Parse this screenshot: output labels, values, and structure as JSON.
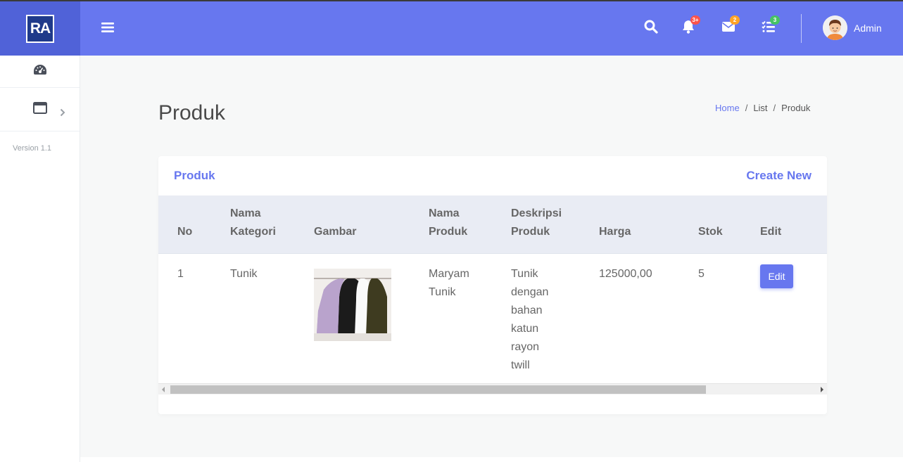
{
  "brand": {
    "logo_text": "RA"
  },
  "sidebar": {
    "version": "Version 1.1"
  },
  "header": {
    "notifications_count": "3+",
    "messages_count": "2",
    "tasks_count": "3",
    "user_name": "Admin",
    "colors": {
      "header_bg": "#6777ef",
      "brand_bg": "#5062d8",
      "badge_red": "#fc544b",
      "badge_orange": "#ffa426",
      "badge_green": "#47c363"
    }
  },
  "page": {
    "title": "Produk",
    "breadcrumb": [
      "Home",
      "List",
      "Produk"
    ]
  },
  "card": {
    "title": "Produk",
    "create_label": "Create New",
    "columns": [
      "No",
      "Nama Kategori",
      "Gambar",
      "Nama Produk",
      "Deskripsi Produk",
      "Harga",
      "Stok",
      "Edit"
    ],
    "rows": [
      {
        "no": "1",
        "kategori": "Tunik",
        "nama": "Maryam Tunik",
        "deskripsi": "Tunik dengan bahan katun rayon twill",
        "harga": "125000,00",
        "stok": "5",
        "edit_label": "Edit"
      }
    ]
  }
}
